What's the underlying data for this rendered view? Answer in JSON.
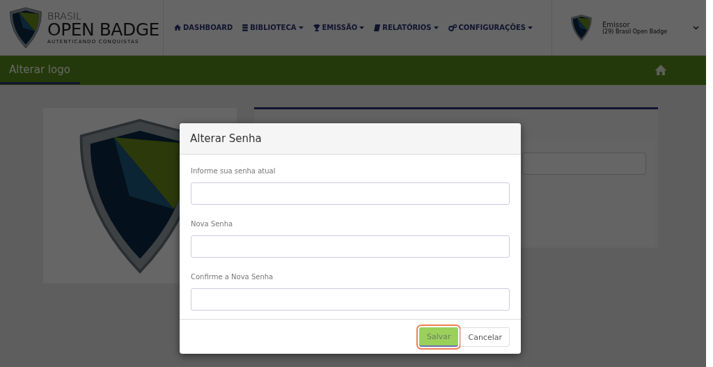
{
  "brand": {
    "top": "BRASIL",
    "name": "OPEN BADGE",
    "tagline": "AUTENTICANDO CONQUISTAS"
  },
  "nav": [
    {
      "label": "DASHBOARD",
      "dropdown": false
    },
    {
      "label": "BIBLIOTECA",
      "dropdown": true
    },
    {
      "label": "EMISSÃO",
      "dropdown": true
    },
    {
      "label": "RELATÓRIOS",
      "dropdown": true
    },
    {
      "label": "CONFIGURAÇÕES",
      "dropdown": true
    }
  ],
  "user": {
    "role": "Emissor",
    "organization": "(29) Brasil Open Badge"
  },
  "page_title": "Alterar logo",
  "modal": {
    "title": "Alterar Senha",
    "fields": [
      {
        "label": "Informe sua senha atual"
      },
      {
        "label": "Nova Senha"
      },
      {
        "label": "Confirme a Nova Senha"
      }
    ],
    "buttons": [
      {
        "label": "Salvar",
        "kind": "primary",
        "focused": true
      },
      {
        "label": "Cancelar",
        "kind": "default",
        "focused": false
      }
    ]
  }
}
